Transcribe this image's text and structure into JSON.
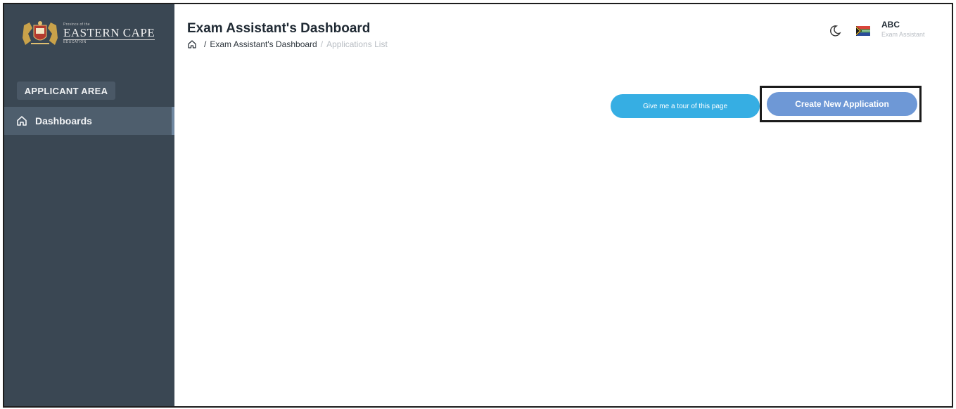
{
  "app": {
    "logo_top": "Province of the",
    "logo_main": "EASTERN CAPE",
    "logo_sub": "EDUCATION"
  },
  "sidebar": {
    "section_label": "APPLICANT AREA",
    "items": [
      {
        "label": "Dashboards",
        "icon": "home-icon",
        "active": true
      }
    ]
  },
  "header": {
    "title": "Exam Assistant's Dashboard",
    "breadcrumb": {
      "separator": "/",
      "items": [
        "Exam Assistant's Dashboard",
        "Applications List"
      ]
    }
  },
  "user": {
    "name": "ABC",
    "role": "Exam Assistant"
  },
  "actions": {
    "tour_label": "Give me a tour of this page",
    "create_label": "Create New Application"
  },
  "colors": {
    "sidebar_bg": "#3a4753",
    "active_item_bg": "#4e5e6d",
    "tour_button": "#36aee3",
    "create_button": "#6e98d6"
  }
}
